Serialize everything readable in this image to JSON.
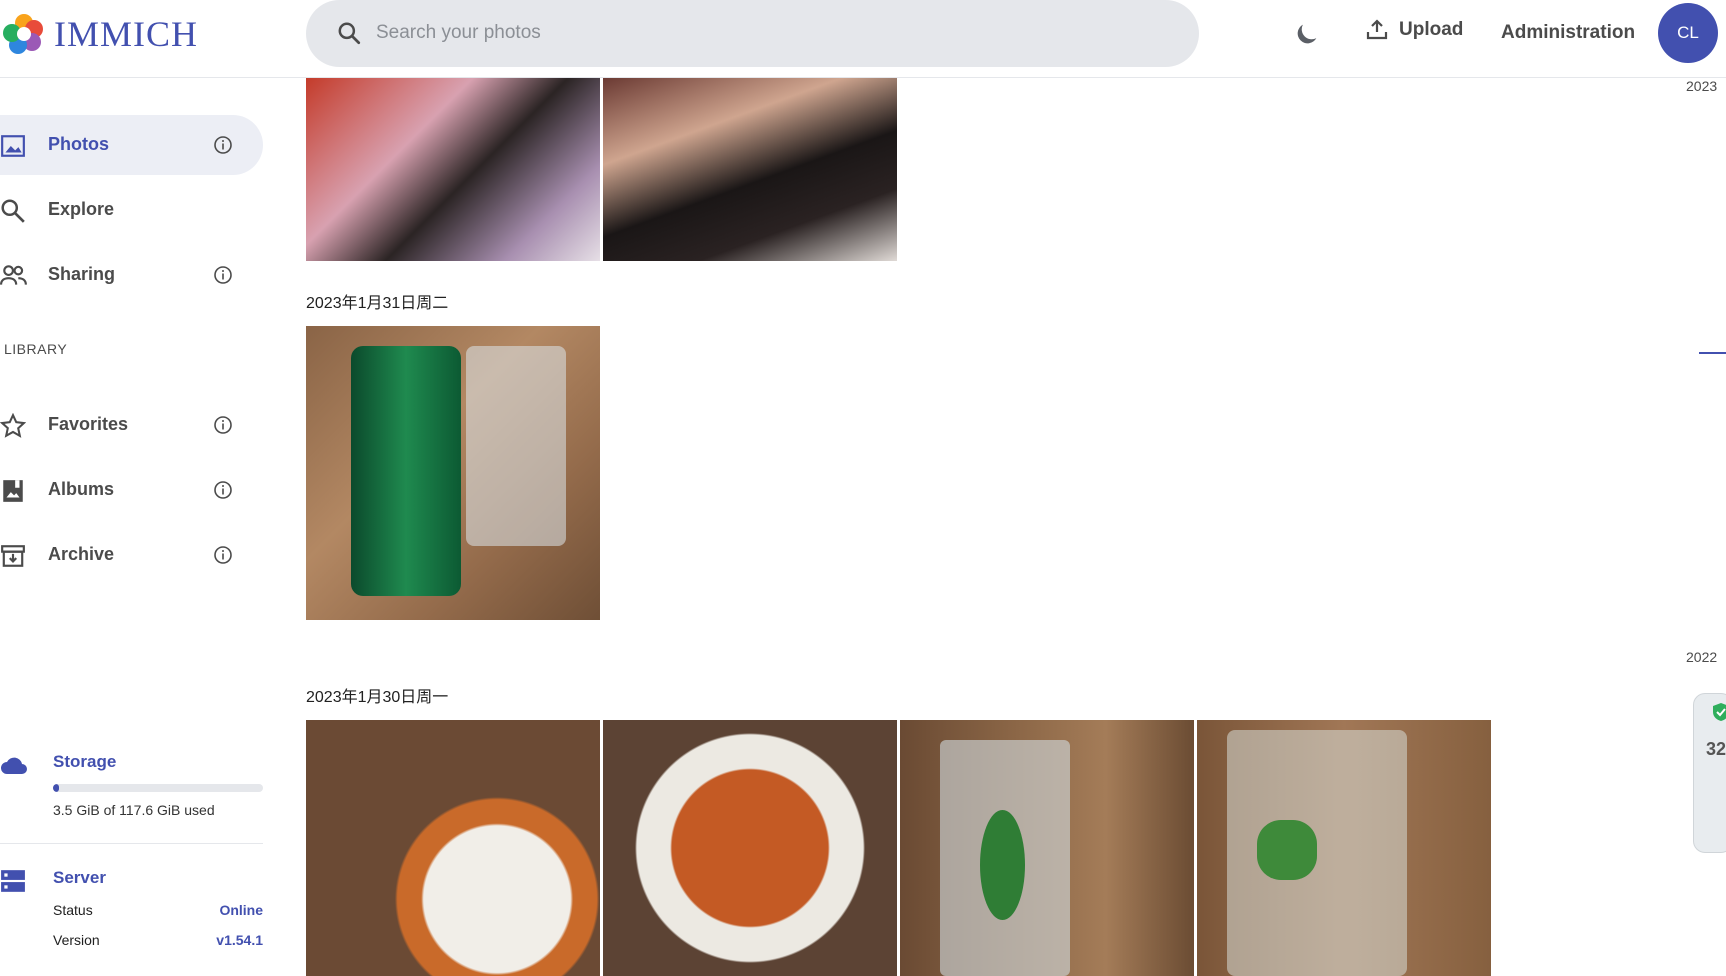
{
  "app": {
    "name": "IMMICH"
  },
  "search": {
    "placeholder": "Search your photos",
    "value": ""
  },
  "header": {
    "upload_label": "Upload",
    "admin_label": "Administration",
    "avatar_initials": "CL"
  },
  "sidebar": {
    "items": [
      {
        "label": "Photos",
        "icon": "photos-icon",
        "active": true
      },
      {
        "label": "Explore",
        "icon": "search-icon"
      },
      {
        "label": "Sharing",
        "icon": "people-icon"
      }
    ],
    "library_heading": "LIBRARY",
    "library_items": [
      {
        "label": "Favorites",
        "icon": "star-icon"
      },
      {
        "label": "Albums",
        "icon": "album-icon"
      },
      {
        "label": "Archive",
        "icon": "archive-icon"
      }
    ]
  },
  "storage": {
    "title": "Storage",
    "used_text": "3.5 GiB of 117.6 GiB used",
    "used_fraction": 0.03
  },
  "server": {
    "title": "Server",
    "status_label": "Status",
    "status_value": "Online",
    "version_label": "Version",
    "version_value": "v1.54.1"
  },
  "timeline": {
    "groups": [
      {
        "date": ""
      },
      {
        "date": "2023年1月31日周二"
      },
      {
        "date": "2023年1月30日周一"
      }
    ]
  },
  "scrubber": {
    "years": [
      "2023",
      "2022"
    ]
  },
  "widget": {
    "value": "32"
  },
  "colors": {
    "accent": "#4250af"
  }
}
